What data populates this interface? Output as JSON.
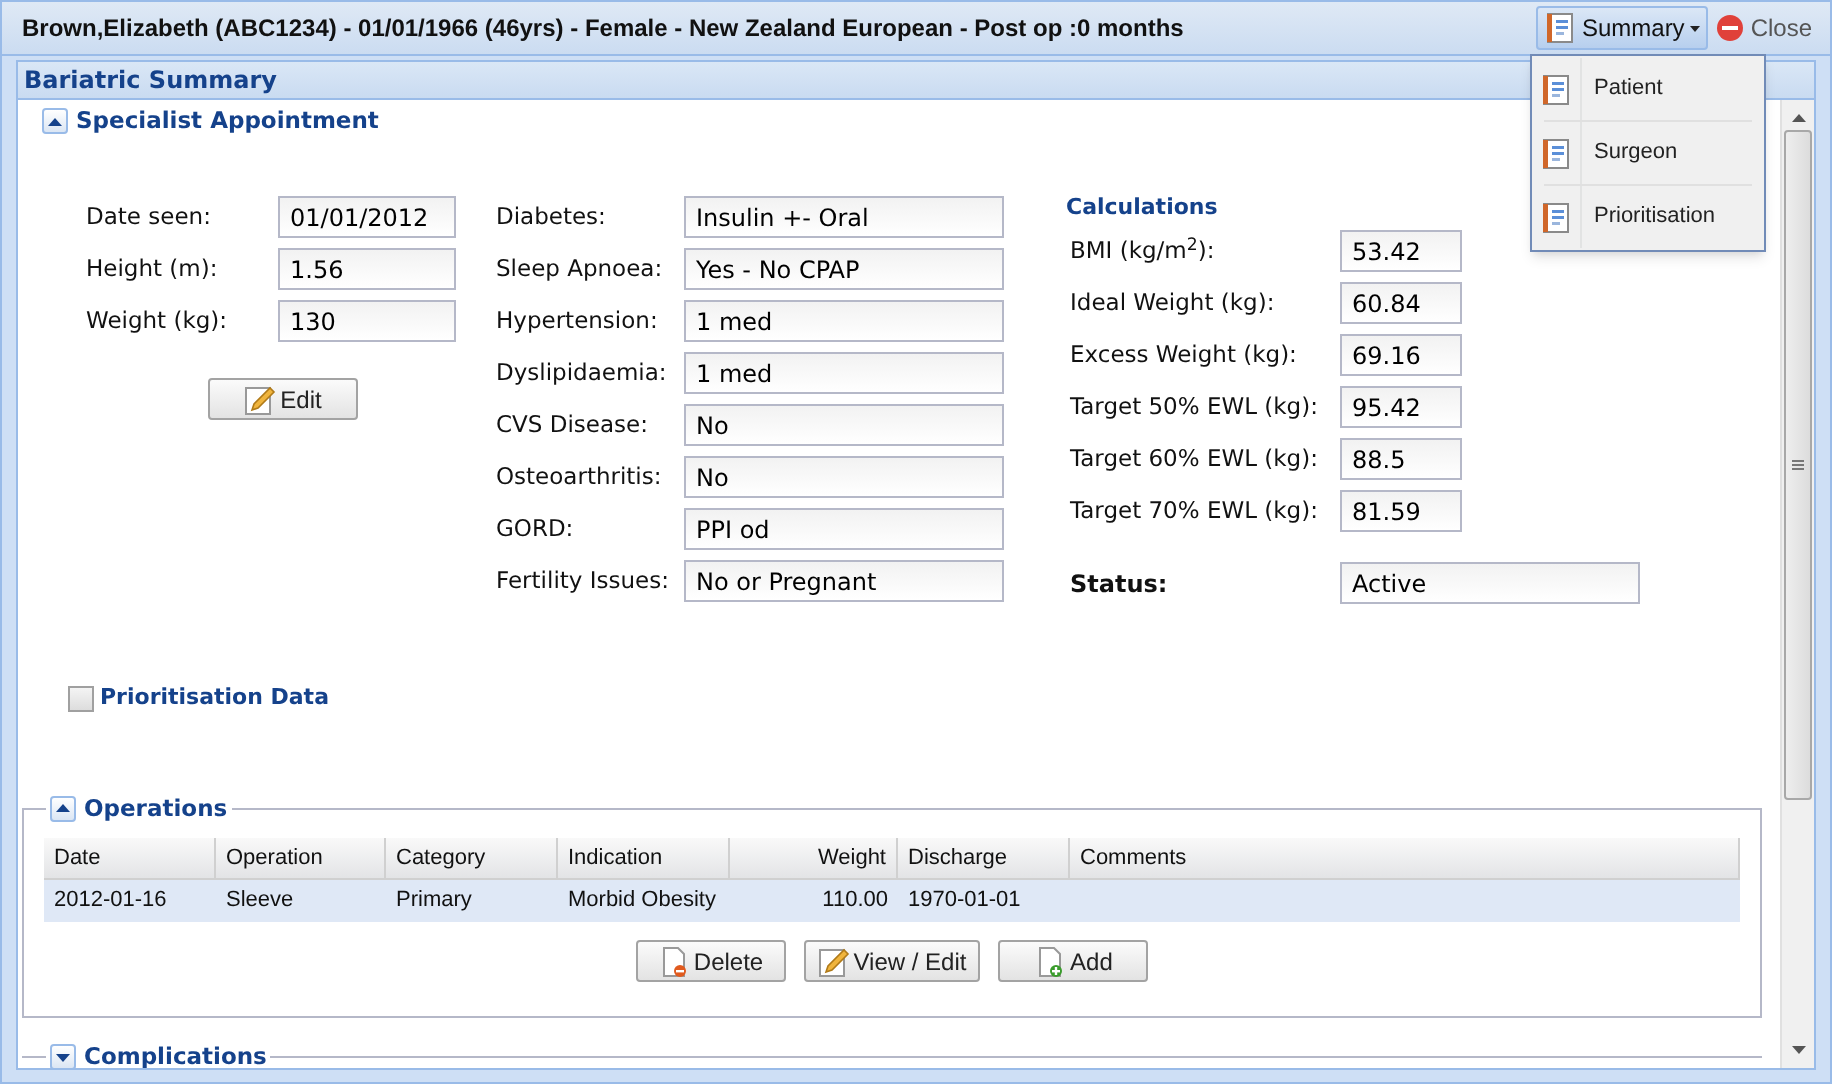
{
  "header": {
    "patient_info": "Brown,Elizabeth (ABC1234) - 01/01/1966 (46yrs) - Female - New Zealand European - Post op :0 months",
    "summary_button": "Summary",
    "close_button": "Close"
  },
  "summary_menu": {
    "items": [
      {
        "label": "Patient"
      },
      {
        "label": "Surgeon"
      },
      {
        "label": "Prioritisation"
      }
    ]
  },
  "panel": {
    "title": "Bariatric Summary"
  },
  "specialist": {
    "title": "Specialist Appointment",
    "expanded": true,
    "measurements": [
      {
        "label": "Date seen:",
        "value": "01/01/2012"
      },
      {
        "label": "Height (m):",
        "value": "1.56"
      },
      {
        "label": "Weight (kg):",
        "value": "130"
      }
    ],
    "edit_button": "Edit",
    "comorbidities": [
      {
        "label": "Diabetes:",
        "value": "Insulin +- Oral"
      },
      {
        "label": "Sleep Apnoea:",
        "value": "Yes - No CPAP"
      },
      {
        "label": "Hypertension:",
        "value": "1 med"
      },
      {
        "label": "Dyslipidaemia:",
        "value": "1 med"
      },
      {
        "label": "CVS Disease:",
        "value": "No"
      },
      {
        "label": "Osteoarthritis:",
        "value": "No"
      },
      {
        "label": "GORD:",
        "value": "PPI od"
      },
      {
        "label": "Fertility Issues:",
        "value": "No or Pregnant"
      }
    ],
    "calculations": {
      "title": "Calculations",
      "fields": [
        {
          "label": "BMI (kg/m$^{2}$):",
          "value": "53.42"
        },
        {
          "label": "Ideal Weight (kg):",
          "value": "60.84"
        },
        {
          "label": "Excess Weight (kg):",
          "value": "69.16"
        },
        {
          "label": "Target 50% EWL (kg):",
          "value": "95.42"
        },
        {
          "label": "Target 60% EWL (kg):",
          "value": "88.5"
        },
        {
          "label": "Target 70% EWL (kg):",
          "value": "81.59"
        }
      ],
      "status": {
        "label": "Status:",
        "value": "Active"
      }
    }
  },
  "prioritisation": {
    "label": "Prioritisation Data",
    "checked": false
  },
  "operations": {
    "title": "Operations",
    "expanded": true,
    "columns": [
      {
        "label": "Date"
      },
      {
        "label": "Operation"
      },
      {
        "label": "Category"
      },
      {
        "label": "Indication"
      },
      {
        "label": "Weight"
      },
      {
        "label": "Discharge"
      },
      {
        "label": "Comments"
      }
    ],
    "rows": [
      {
        "cells": [
          "2012-01-16",
          "Sleeve",
          "Primary",
          "Morbid Obesity",
          "110.00",
          "1970-01-01",
          ""
        ],
        "selected": true
      }
    ],
    "buttons": [
      {
        "kind": "delete",
        "label": "Delete"
      },
      {
        "kind": "edit",
        "label": "View / Edit"
      },
      {
        "kind": "add",
        "label": "Add"
      }
    ]
  },
  "complications": {
    "title": "Complications",
    "expanded": false
  }
}
